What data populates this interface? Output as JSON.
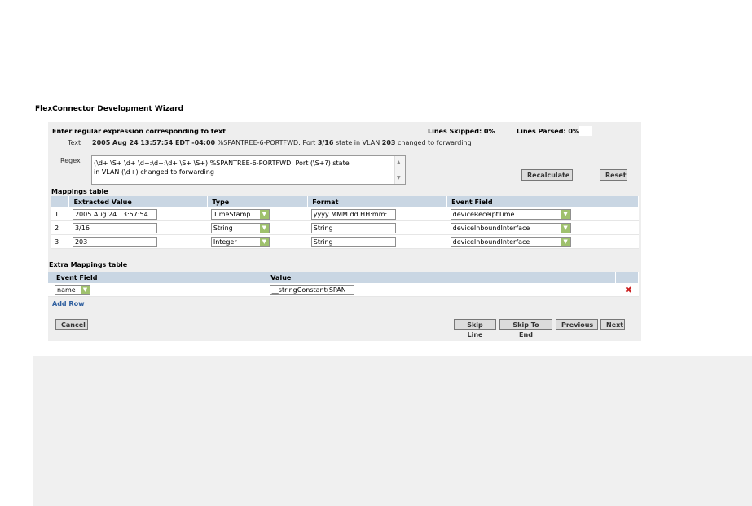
{
  "wizard": {
    "title": "FlexConnector Development Wizard"
  },
  "header": {
    "instruction": "Enter regular expression corresponding to text",
    "lines_skipped": "Lines Skipped: 0%",
    "lines_parsed": "Lines Parsed: 0%"
  },
  "text_row": {
    "label": "Text",
    "value_parts": [
      "2005 Aug 24 13:57:54 EDT -04:00",
      " %SPANTREE-6-PORTFWD: Port ",
      "3/16",
      " state in VLAN ",
      "203",
      " changed to forwarding"
    ]
  },
  "regex": {
    "label": "Regex",
    "line1": "(\\d+ \\S+ \\d+ \\d+:\\d+:\\d+ \\S+ \\S+) %SPANTREE-6-PORTFWD: Port (\\S+?) state",
    "line2": "in VLAN (\\d+) changed to forwarding"
  },
  "buttons": {
    "recalculate": "Recalculate",
    "reset": "Reset",
    "cancel": "Cancel",
    "skip_line": "Skip Line",
    "skip_to_end": "Skip To End",
    "previous": "Previous",
    "next": "Next"
  },
  "mappings": {
    "title": "Mappings table",
    "columns": [
      "Extracted Value",
      "Type",
      "Format",
      "Event Field"
    ],
    "rows": [
      {
        "num": "1",
        "value": "2005 Aug 24 13:57:54",
        "type": "TimeStamp",
        "format": "yyyy MMM dd HH:mm:",
        "event": "deviceReceiptTime"
      },
      {
        "num": "2",
        "value": "3/16",
        "type": "String",
        "format": "String",
        "event": "deviceInboundInterface"
      },
      {
        "num": "3",
        "value": "203",
        "type": "Integer",
        "format": "String",
        "event": "deviceInboundInterface"
      }
    ]
  },
  "extra_mappings": {
    "title": "Extra Mappings table",
    "columns": [
      "Event Field",
      "Value"
    ],
    "rows": [
      {
        "field": "name",
        "value": "__stringConstant(SPAN"
      }
    ],
    "add_row": "Add Row"
  },
  "icons": {
    "dropdown": "chevron-down-icon",
    "delete": "delete-x-icon"
  },
  "colors": {
    "header_bg": "#c9d6e3",
    "dropdown_green": "#9fc16d",
    "delete_red": "#cc2222",
    "link_blue": "#2f5f9f"
  }
}
